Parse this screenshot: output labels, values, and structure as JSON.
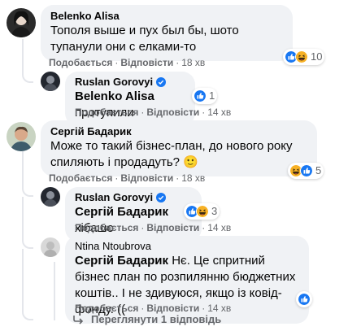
{
  "ui": {
    "like_label": "Подобається",
    "reply_label": "Відповісти",
    "separator": "·"
  },
  "comments": [
    {
      "author": "Belenko Alisa",
      "text": "Тополя выше и пух был бы, шото тупанули они с елками-то",
      "time": "18 хв",
      "reaction_count": "10",
      "reactions": [
        "like-icon",
        "haha-icon"
      ]
    },
    {
      "author": "Ruslan Gorovyi",
      "verified": true,
      "mention": "Belenko Alisa",
      "text": "протупили",
      "time": "14 хв",
      "reaction_count": "1",
      "reactions": [
        "like-icon"
      ]
    },
    {
      "author": "Сергій Бадарик",
      "text": "Може то такий бізнес-план, до нового року спиляють і продадуть?",
      "emoji": "🙂",
      "time": "18 хв",
      "reaction_count": "5",
      "reactions": [
        "haha-icon",
        "like-icon"
      ]
    },
    {
      "author": "Ruslan Gorovyi",
      "verified": true,
      "mention": "Сергій Бадарик",
      "text": "хібашо",
      "time": "14 хв",
      "reaction_count": "3",
      "reactions": [
        "like-icon",
        "haha-icon"
      ]
    },
    {
      "author": "Ntina Ntoubrova",
      "mention": "Сергій Бадарик",
      "text": "Нє. Це спритний бізнес план по розпилянню бюджетних коштів.. І не здивуюся, якщо із ковід-фонду. ((",
      "time": "14 хв",
      "reaction_count": "",
      "reactions": [
        "like-icon"
      ]
    }
  ],
  "view_replies": "Переглянути 1 відповідь",
  "colors": {
    "bubble": "#f0f2f5",
    "secondary_text": "#65676b",
    "like_blue": "#1877f2",
    "haha_yellow": "#f7b125"
  }
}
